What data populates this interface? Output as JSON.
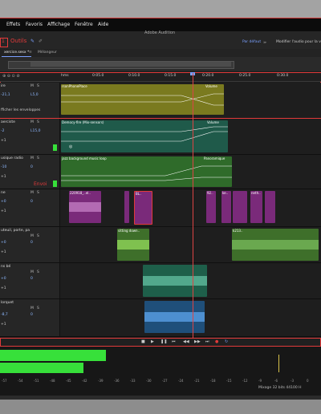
{
  "menu": {
    "items": [
      "Effets",
      "Favoris",
      "Affichage",
      "Fenêtre",
      "Aide"
    ],
    "app_title": "Adobe Audition"
  },
  "toolbar": {
    "annotation_number": "1",
    "annotation_label": "Outils",
    "default_label": "Par défaut",
    "modify_label": "Modifier l'audio pour la v"
  },
  "tabs": {
    "session": "xercice.sesx *",
    "close": "≡",
    "mixer": "Mélangeur"
  },
  "ruler": {
    "unit": "hms",
    "ticks": [
      "0:05.0",
      "0:10.0",
      "0:15.0",
      "0:20.0",
      "0:25.0",
      "0:30.0"
    ]
  },
  "tracks": [
    {
      "name": "ire",
      "m": "M",
      "s": "S",
      "vol": "-21,1",
      "pan": "L5,0",
      "extra": "fficher les enveloppes",
      "clips": [
        {
          "label": "rsonPhonePlace",
          "envelope_label": "Volume",
          "color": "#7a7a1f"
        }
      ]
    },
    {
      "name": "aerciste",
      "m": "M",
      "s": "S",
      "vol": "-2",
      "pan": "L15,0",
      "plus": "+1",
      "clips": [
        {
          "label": "Democy-fire (Mix-sensors)",
          "envelope_label": "Volume",
          "color": "#1f5a4a"
        }
      ]
    },
    {
      "name": "usique radio",
      "m": "M",
      "s": "S",
      "vol": "-10",
      "pan": "0",
      "plus": "+1",
      "annotation": "Envoi",
      "clips": [
        {
          "label": "jazz background music loop",
          "envelope_label": "Panoramique",
          "color": "#2f6b2a"
        }
      ]
    },
    {
      "name": "ne",
      "m": "M",
      "s": "S",
      "vol": "+0",
      "pan": "0",
      "plus": "+1",
      "clips": [
        {
          "label": "220918_..el..",
          "color": "#7a2a7a"
        },
        {
          "label": "BL..",
          "color": "#7a2a7a"
        },
        {
          "label": "92..",
          "color": "#7a2a7a"
        },
        {
          "label": "ke..",
          "color": "#7a2a7a"
        },
        {
          "label": "neth..",
          "color": "#7a2a7a"
        }
      ]
    },
    {
      "name": "uteuil, porte, pa",
      "m": "M",
      "s": "S",
      "vol": "+0",
      "pan": "0",
      "plus": "+1",
      "clips": [
        {
          "label": "sitting down..",
          "color": "#3e6f2a"
        },
        {
          "label": "k213..",
          "color": "#3e6f2a"
        }
      ]
    },
    {
      "name": "ns bé",
      "m": "M",
      "s": "S",
      "vol": "+0",
      "pan": "0",
      "plus": "+1",
      "clips": [
        {
          "label": "",
          "color": "#1e5f4a"
        }
      ]
    },
    {
      "name": "lorquet",
      "m": "M",
      "s": "S",
      "vol": "-8,7",
      "pan": "0",
      "plus": "+1",
      "clips": [
        {
          "label": "",
          "color": "#1f4f7a"
        }
      ]
    }
  ],
  "meter": {
    "scale": [
      "-57",
      "-54",
      "-51",
      "-48",
      "-45",
      "-42",
      "-39",
      "-36",
      "-33",
      "-30",
      "-27",
      "-24",
      "-21",
      "-18",
      "-15",
      "-12",
      "-9",
      "-6",
      "-3",
      "0"
    ],
    "level_left": 0.33,
    "level_right": 0.26,
    "footer": "Mixage 32 bits 44100 H"
  },
  "colors": {
    "accent_red": "#e23a3a",
    "meter_green": "#37e03a",
    "playhead": "#d44"
  }
}
